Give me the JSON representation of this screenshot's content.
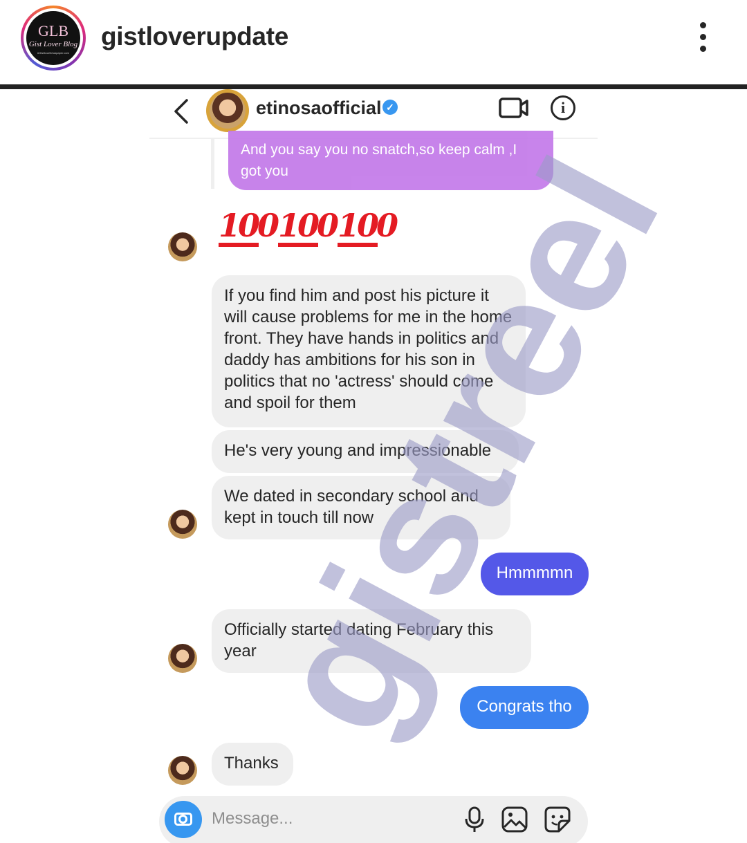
{
  "post_header": {
    "username": "gistloverupdate",
    "logo_big": "GLB",
    "logo_small": "Gist Lover Blog",
    "logo_tiny": "#Gist4ourNewspaper.com",
    "more_icon": "vertical-ellipsis-icon"
  },
  "dm_header": {
    "contact_name": "etinosaofficial",
    "verified_icon": "verified-badge-icon",
    "back_icon": "chevron-left-icon",
    "video_icon": "video-call-icon",
    "info_icon": "info-icon"
  },
  "messages": {
    "replied_preview": "And you say you no snatch,so keep calm ,I got you",
    "emoji": "100",
    "m1": "If you find him and post his picture it will cause problems for me in the home front. They have hands in politics and daddy has ambitions for his son in politics that no 'actress' should come and spoil for them",
    "m2": "He's very young and impressionable",
    "m3": "We dated in secondary school and kept in touch till now",
    "m4": "Hmmmmn",
    "m5": "Officially started dating February this year",
    "m6": "Congrats tho",
    "m7": "Thanks"
  },
  "composer": {
    "placeholder": "Message...",
    "camera_icon": "camera-icon",
    "mic_icon": "microphone-icon",
    "gallery_icon": "image-icon",
    "sticker_icon": "sticker-icon"
  },
  "watermark": {
    "text": "gistreel"
  },
  "colors": {
    "sent_purple": "#c379e9",
    "sent_indigo": "#5458e8",
    "sent_blue": "#3b82f0",
    "received_gray": "#efefef",
    "watermark": "#9c9cc8"
  }
}
